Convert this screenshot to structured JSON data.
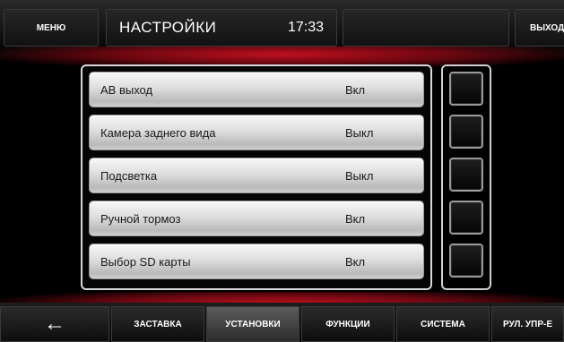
{
  "header": {
    "menu_label": "МЕНЮ",
    "title": "НАСТРОЙКИ",
    "time": "17:33",
    "exit_label": "ВЫХОД"
  },
  "settings": [
    {
      "label": "АВ выход",
      "value": "Вкл"
    },
    {
      "label": "Камера заднего вида",
      "value": "Выкл"
    },
    {
      "label": "Подсветка",
      "value": "Выкл"
    },
    {
      "label": "Ручной тормоз",
      "value": "Вкл"
    },
    {
      "label": "Выбор SD карты",
      "value": "Вкл"
    }
  ],
  "bottom_tabs": {
    "back_icon": "←",
    "items": [
      "ЗАСТАВКА",
      "УСТАНОВКИ",
      "ФУНКЦИИ",
      "СИСТЕМА",
      "РУЛ. УПР-Е"
    ],
    "active": "УСТАНОВКИ"
  },
  "colors": {
    "accent_red": "#c0101e",
    "row_gradient_top": "#f7f7f7",
    "row_gradient_bottom": "#b9b9b9"
  }
}
